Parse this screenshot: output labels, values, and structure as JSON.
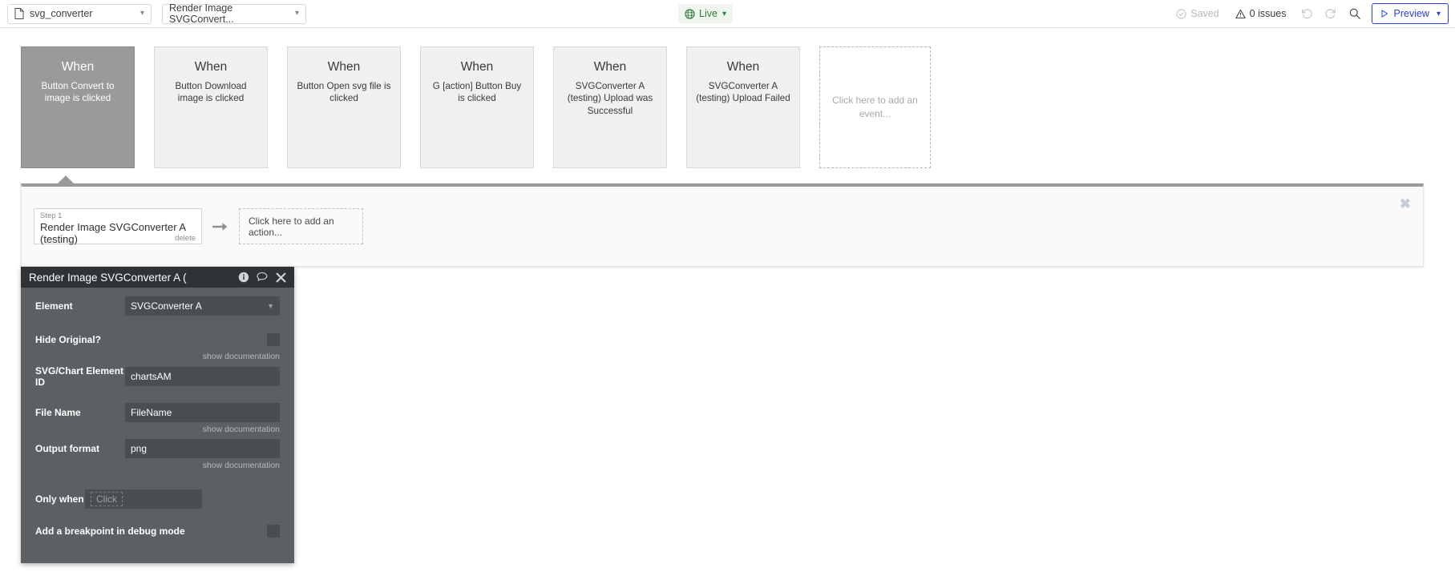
{
  "topbar": {
    "app_select": {
      "value": "svg_converter",
      "icon": "document-icon"
    },
    "tab_select": {
      "value": "Render Image SVGConvert...",
      "icon": "chevron-down-icon"
    },
    "live_badge": {
      "label": "Live",
      "icon": "globe-icon",
      "color": "#2f7a3d",
      "bg": "#eef6ee"
    },
    "saved": {
      "label": "Saved",
      "icon": "check-circle-icon"
    },
    "issues": {
      "label": "0 issues",
      "icon": "warning-triangle-icon"
    },
    "undo": {
      "icon": "undo-icon"
    },
    "redo": {
      "icon": "redo-icon"
    },
    "search": {
      "icon": "search-icon"
    },
    "preview": {
      "label": "Preview",
      "icon": "play-icon",
      "color": "#2a42d8"
    }
  },
  "events": {
    "when_label": "When",
    "cards": [
      {
        "title": "When",
        "desc": "Button Convert to image is clicked",
        "selected": true
      },
      {
        "title": "When",
        "desc": "Button Download image is clicked",
        "selected": false
      },
      {
        "title": "When",
        "desc": "Button Open svg file is clicked",
        "selected": false
      },
      {
        "title": "When",
        "desc": "G [action] Button Buy is clicked",
        "selected": false
      },
      {
        "title": "When",
        "desc": "SVGConverter A (testing) Upload was Successful",
        "selected": false
      },
      {
        "title": "When",
        "desc": "SVGConverter A (testing) Upload Failed",
        "selected": false
      }
    ],
    "add_card_label": "Click here to add an event..."
  },
  "action_panel": {
    "close_label": "✖",
    "step": {
      "number_label": "Step 1",
      "title": "Render Image SVGConverter A (testing)",
      "delete_label": "delete"
    },
    "arrow": "➜",
    "add_action_label": "Click here to add an action..."
  },
  "properties": {
    "title": "Render Image SVGConverter A (",
    "title_icons": [
      "info-icon",
      "comment-icon",
      "close-icon"
    ],
    "show_documentation_label": "show documentation",
    "fields": {
      "element": {
        "label": "Element",
        "value": "SVGConverter A",
        "type": "dropdown"
      },
      "hide_original": {
        "label": "Hide Original?",
        "value": "",
        "type": "checkbox"
      },
      "svg_chart_element_id": {
        "label": "SVG/Chart Element ID",
        "value": "chartsAM",
        "type": "text"
      },
      "file_name": {
        "label": "File Name",
        "value": "FileName",
        "type": "text"
      },
      "output_format": {
        "label": "Output format",
        "value": "png",
        "type": "text"
      },
      "only_when": {
        "label": "Only when",
        "placeholder": "Click",
        "value": "",
        "type": "expression"
      },
      "breakpoint": {
        "label": "Add a breakpoint in debug mode",
        "value": "",
        "type": "checkbox"
      }
    }
  }
}
